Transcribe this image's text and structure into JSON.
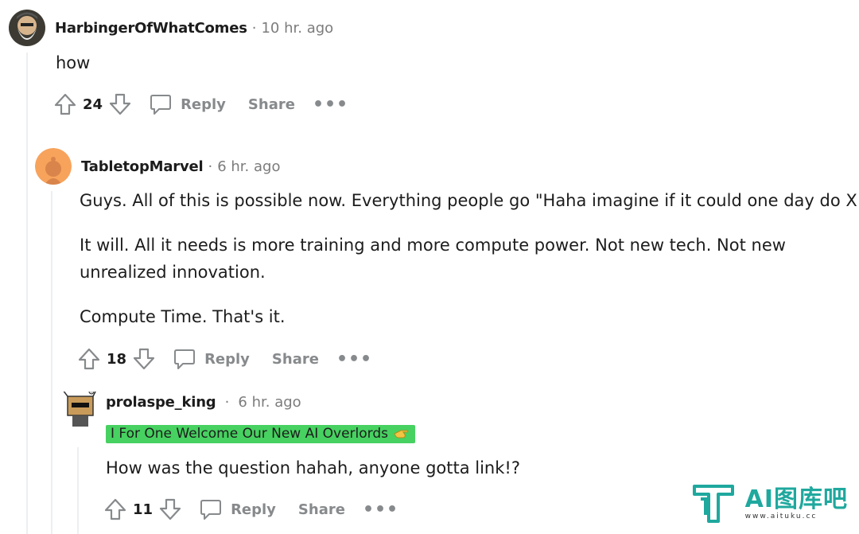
{
  "comments": [
    {
      "author": "HarbingerOfWhatComes",
      "separator": "·",
      "time": "10 hr. ago",
      "paragraphs": [
        "how"
      ],
      "score": "24",
      "reply_label": "Reply",
      "share_label": "Share",
      "more_label": "•••"
    },
    {
      "author": "TabletopMarvel",
      "separator": "·",
      "time": "6 hr. ago",
      "paragraphs": [
        "Guys. All of this is possible now. Everything people go \"Haha imagine if it could one day do X.\"",
        "It will. All it needs is more training and more compute power. Not new tech. Not new unrealized innovation.",
        "Compute Time. That's it."
      ],
      "score": "18",
      "reply_label": "Reply",
      "share_label": "Share",
      "more_label": "•••"
    },
    {
      "author": "prolaspe_king",
      "separator": "·",
      "time": "6 hr. ago",
      "flair": "I For One Welcome Our New AI Overlords",
      "paragraphs": [
        "How was the question hahah, anyone gotta link!?"
      ],
      "score": "11",
      "reply_label": "Reply",
      "share_label": "Share",
      "more_label": "•••"
    }
  ],
  "watermark": {
    "title": "AI图库吧",
    "url": "www.aituku.cc"
  },
  "colors": {
    "flair_bg": "#46d160",
    "muted": "#878a8c",
    "thread_line": "#eceef0",
    "watermark": "#1fa89e"
  }
}
